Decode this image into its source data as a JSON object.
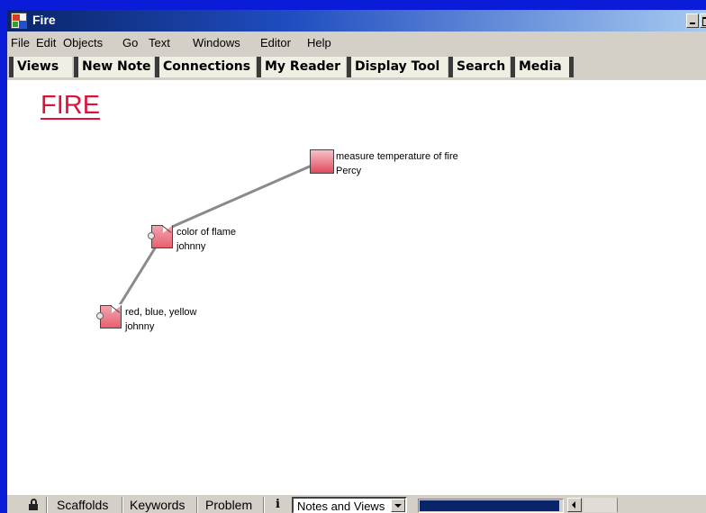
{
  "window": {
    "title": "Fire"
  },
  "menubar": {
    "items": [
      "File",
      "Edit",
      "Objects",
      "Go",
      "Text",
      "Windows",
      "Editor",
      "Help"
    ]
  },
  "toolbar": {
    "buttons": [
      "Views",
      "New Note",
      "Connections",
      "My Reader",
      "Display Tool",
      "Search",
      "Media"
    ]
  },
  "view": {
    "title": "FIRE",
    "notes": [
      {
        "title": "measure temperature of fire",
        "author": "Percy"
      },
      {
        "title": "color of flame",
        "author": "johnny"
      },
      {
        "title": "red, blue, yellow",
        "author": "johnny"
      }
    ]
  },
  "statusbar": {
    "tabs": [
      "Scaffolds",
      "Keywords",
      "Problem"
    ],
    "info_icon": "i",
    "select_value": "Notes and Views",
    "progress": 0.98
  },
  "colors": {
    "desktop": "#0a1cd8",
    "title_accent": "#dc143c",
    "note_fill": "#e8606e",
    "link_line": "#8a8a8a"
  },
  "icons": [
    "app-icon",
    "minimize-icon",
    "maximize-icon",
    "note-icon",
    "lock-icon",
    "info-icon",
    "dropdown-arrow-icon",
    "scroll-left-icon"
  ]
}
